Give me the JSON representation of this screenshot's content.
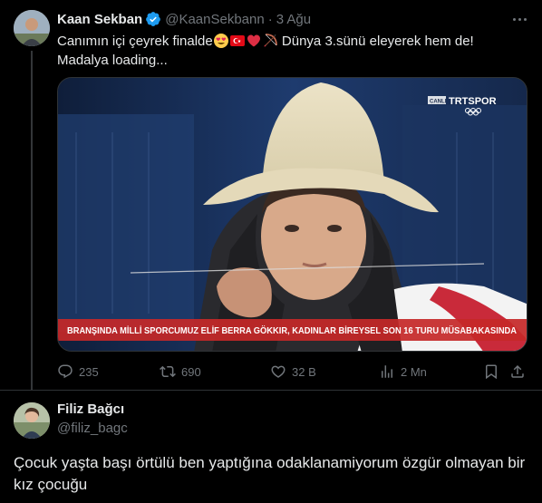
{
  "tweet": {
    "author_name": "Kaan Sekban",
    "handle": "@KaanSekbann",
    "separator": "·",
    "time": "3 Ağu",
    "text_part1": "Canımın içi çeyrek finalde",
    "text_part2": " Dünya 3.sünü eleyerek hem de!",
    "text_line2": "Madalya loading...",
    "emojis": [
      "heart-eyes-emoji",
      "turkey-flag-emoji",
      "red-heart-emoji",
      "bow-and-arrow-emoji"
    ],
    "media": {
      "channel_logo_prefix": "CANLI",
      "channel_logo": "TRTSPOR",
      "caption": "BRANŞINDA MİLLİ SPORCUMUZ ELİF BERRA GÖKKIR, KADINLAR BİREYSEL SON 16 TURU MÜSABAKASINDA"
    },
    "stats": {
      "replies": "235",
      "retweets": "690",
      "likes": "32 B",
      "views": "2 Mn"
    },
    "accent_color": "#1d9bf0"
  },
  "reply": {
    "author_name": "Filiz Bağcı",
    "handle": "@filiz_bagc",
    "text": "Çocuk yaşta başı örtülü ben yaptığına odaklanamiyorum özgür olmayan bir kız çocuğu"
  },
  "colors": {
    "background": "#000000",
    "text_primary": "#e7e9ea",
    "text_secondary": "#71767b",
    "border": "#2f3336",
    "caption_bg": "#c62828"
  }
}
